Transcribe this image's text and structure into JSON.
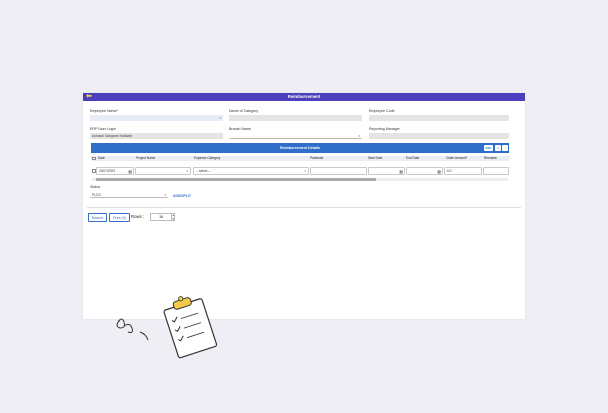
{
  "header": {
    "title": "Reimbursement",
    "back_icon": "arrow-left-icon"
  },
  "form": {
    "employee_name": {
      "label": "Employee Name*",
      "value": ""
    },
    "name_of_category": {
      "label": "Name of Category",
      "value": ""
    },
    "employee_code": {
      "label": "Employee Code",
      "value": ""
    },
    "erp_user_login": {
      "label": "ERP User Login",
      "value": "Avinash Sangram Hadkale"
    },
    "branch_name": {
      "label": "Branch Name",
      "value": ""
    },
    "reporting_manager": {
      "label": "Reporting Manager",
      "value": ""
    }
  },
  "reimbursement_details": {
    "title": "Reimbursement Details",
    "buttons": [
      "Edit",
      "+",
      "-"
    ],
    "columns": [
      "Date",
      "Project Name",
      "Expense Category",
      "Particular",
      "Start Date",
      "End Date",
      "Claim Amount*",
      "Remarks"
    ],
    "row": {
      "date": "20/07/2023",
      "project_name": "",
      "expense_category": "-- select --",
      "particular": "",
      "start_date": "",
      "end_date": "",
      "claim_amount": "0.0",
      "remarks": ""
    }
  },
  "status": {
    "label": "Status",
    "value": "PLDC"
  },
  "add_split_label": "ADD/SPLIT",
  "actions": {
    "search_label": "Search",
    "print_label": "Print (0)",
    "rows_label": "Rows :",
    "rows_value": "15"
  },
  "colors": {
    "titlebar": "#4b3fbd",
    "section_header": "#2f6ec9",
    "accent": "#f2c94c"
  }
}
